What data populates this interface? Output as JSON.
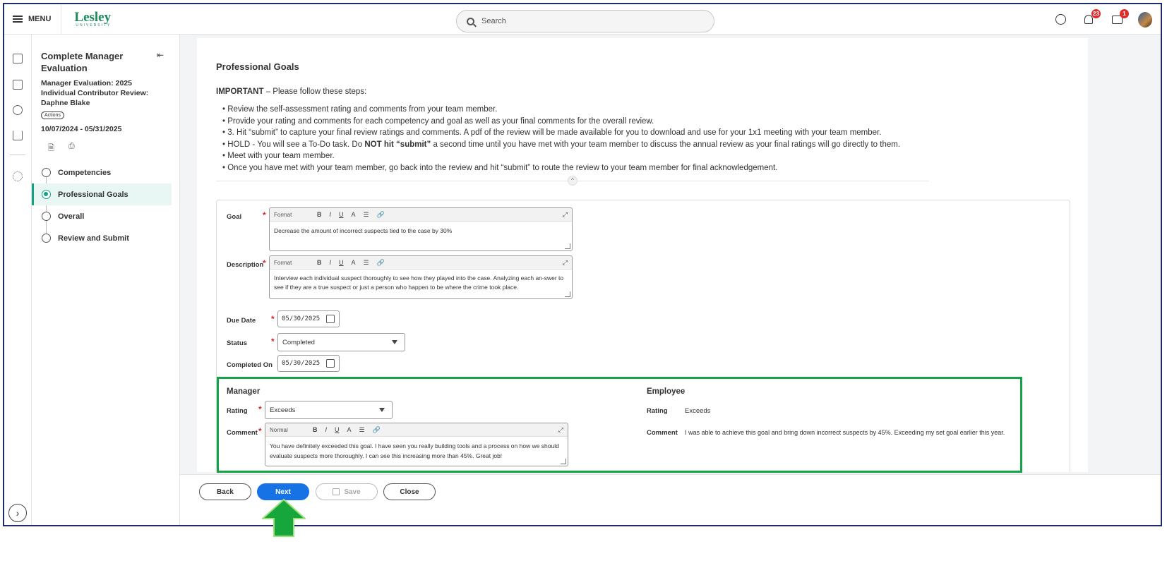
{
  "header": {
    "menu_label": "MENU",
    "logo_text": "Lesley",
    "logo_sub": "UNIVERSITY",
    "search_placeholder": "Search",
    "notifications_count": "23",
    "inbox_count": "1",
    "icons": [
      "menu-icon",
      "search-icon",
      "chat-icon",
      "bell-icon",
      "inbox-icon",
      "avatar"
    ]
  },
  "rail": {
    "icons": [
      "dashboard-icon",
      "report-icon",
      "search-insights-icon",
      "bar-chart-icon",
      "gear-icon",
      "expand-icon"
    ]
  },
  "side": {
    "title": "Complete Manager Evaluation",
    "subtitle": "Manager Evaluation: 2025 Individual Contributor Review: Daphne Blake",
    "actions_label": "Actions",
    "dates": "10/07/2024 - 05/31/2025",
    "steps": [
      {
        "label": "Competencies",
        "active": false
      },
      {
        "label": "Professional Goals",
        "active": true
      },
      {
        "label": "Overall",
        "active": false
      },
      {
        "label": "Review and Submit",
        "active": false
      }
    ]
  },
  "main": {
    "heading": "Professional Goals",
    "important_bold": "IMPORTANT",
    "important_rest": " – Please follow these steps:",
    "instructions": {
      "i1": "Review the self-assessment rating and comments from your team member.",
      "i2": "Provide your rating and comments for each competency and goal as well as your final comments for the overall review.",
      "i3": "3. Hit “submit” to capture your final review ratings and comments. A pdf of the review will be made available for you to download and use for your 1x1 meeting with your team member.",
      "i4a": "HOLD - You will see a To-Do task. Do ",
      "i4b": "NOT hit “submit”",
      "i4c": " a second time until you have met with your team member to discuss the annual review as your final ratings will go directly to them.",
      "i5": "Meet with your team member.",
      "i6": "Once you have met with your team member, go back into the review and hit “submit” to route the review to your team member for final acknowledgement."
    },
    "form": {
      "goal_label": "Goal",
      "goal_value": "Decrease the amount of incorrect suspects tied to the case by 30%",
      "description_label": "Description",
      "description_value": "Interview each individual suspect thoroughly to see how they played into the case. Analyzing each an-swer to see if they are a true suspect or just a person who happen to be where the crime took place.",
      "format_label": "Format",
      "due_date_label": "Due Date",
      "due_date_value": "05/30/2025",
      "status_label": "Status",
      "status_value": "Completed",
      "completed_on_label": "Completed On",
      "completed_on_value": "05/30/2025"
    },
    "manager": {
      "title": "Manager",
      "rating_label": "Rating",
      "rating_value": "Exceeds",
      "comment_label": "Comment",
      "normal_label": "Normal",
      "comment_value": "You have definitely exceeded this goal. I have seen you really building tools and a process on how we should evaluate suspects more thoroughly.  I can see this increasing more than 45%. Great job!"
    },
    "employee": {
      "title": "Employee",
      "rating_label": "Rating",
      "rating_value": "Exceeds",
      "comment_label": "Comment",
      "comment_value": "I was able to achieve this goal and bring down incorrect suspects by 45%. Exceeding my set goal earlier this year."
    }
  },
  "footer": {
    "back_label": "Back",
    "next_label": "Next",
    "save_label": "Save",
    "close_label": "Close"
  },
  "colors": {
    "accent": "#1772e6",
    "active_step": "#17a085",
    "highlight_box": "#15a34a",
    "badge": "#de2b2b",
    "brand": "#1a8a5a"
  }
}
